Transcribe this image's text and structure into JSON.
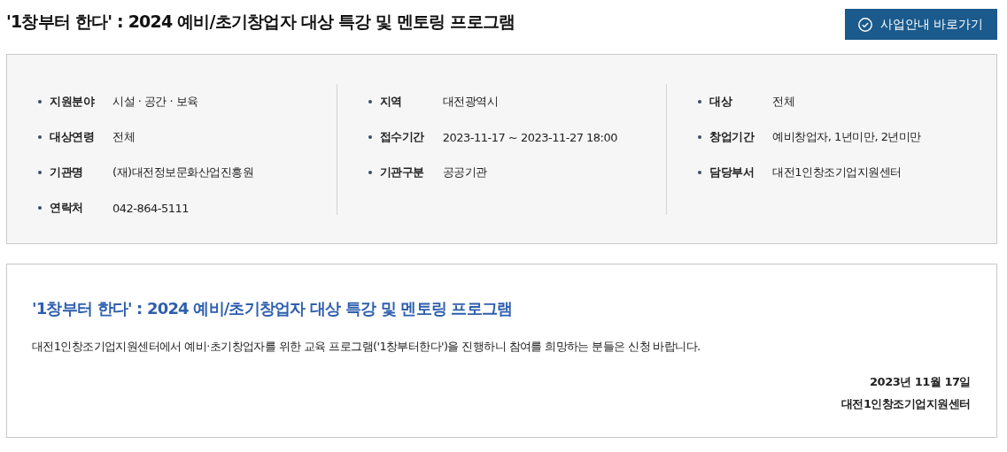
{
  "header": {
    "title": "'1창부터 한다' : 2024 예비/초기창업자 대상 특강 및 멘토링 프로그램",
    "button": "사업안내 바로가기"
  },
  "info_columns": [
    [
      {
        "label": "지원분야",
        "value": "시설 · 공간 · 보육"
      },
      {
        "label": "대상연령",
        "value": "전체"
      },
      {
        "label": "기관명",
        "value": "(재)대전정보문화산업진흥원"
      },
      {
        "label": "연락처",
        "value": "042-864-5111"
      }
    ],
    [
      {
        "label": "지역",
        "value": "대전광역시"
      },
      {
        "label": "접수기간",
        "value": "2023-11-17 ~ 2023-11-27 18:00"
      },
      {
        "label": "기관구분",
        "value": "공공기관"
      }
    ],
    [
      {
        "label": "대상",
        "value": "전체"
      },
      {
        "label": "창업기간",
        "value": "예비창업자, 1년미만, 2년미만"
      },
      {
        "label": "담당부서",
        "value": "대전1인창조기업지원센터"
      }
    ]
  ],
  "notice": {
    "title": "'1창부터 한다' : 2024 예비/초기창업자 대상 특강 및 멘토링 프로그램",
    "body": "대전1인창조기업지원센터에서 예비·초기창업자를 위한 교육 프로그램('1창부터한다')을 진행하니 참여를 희망하는 분들은 신청 바랍니다.",
    "date": "2023년 11월 17일",
    "signature": "대전1인창조기업지원센터"
  }
}
